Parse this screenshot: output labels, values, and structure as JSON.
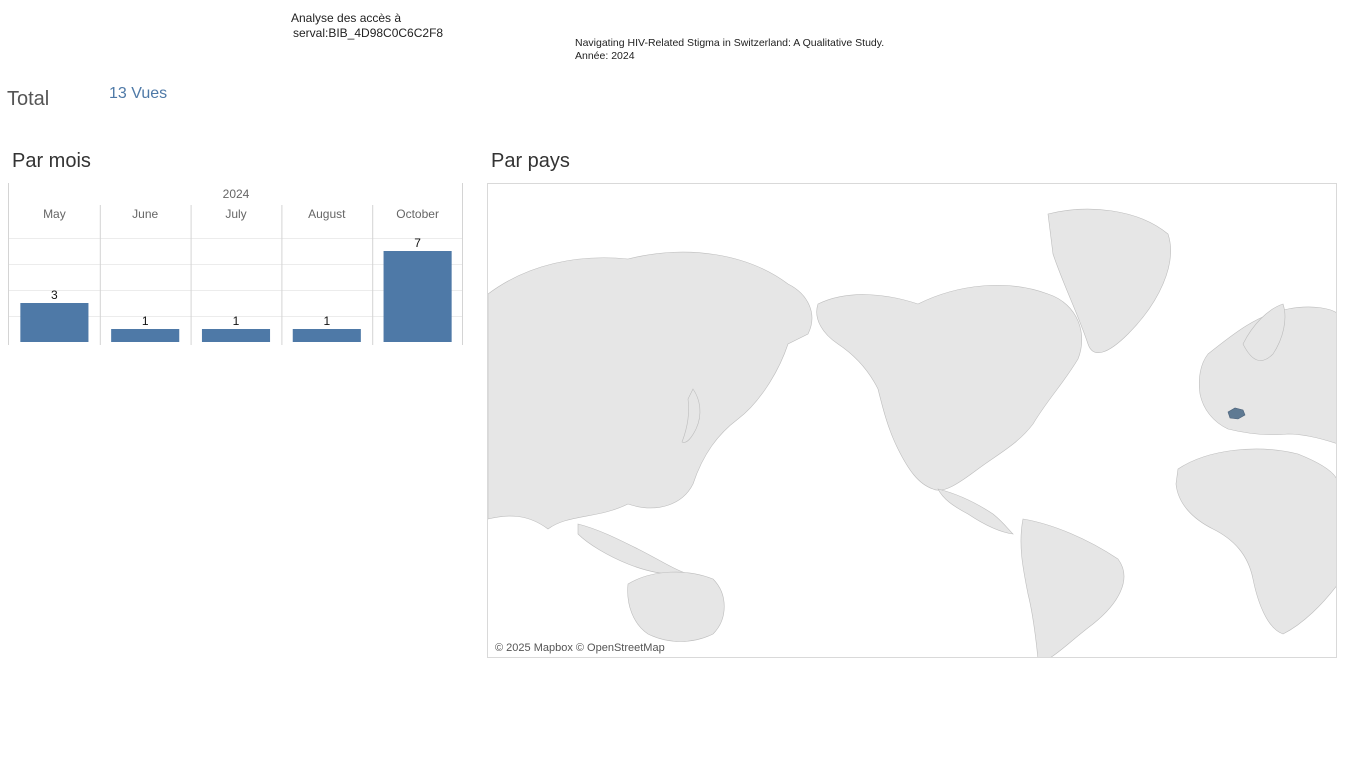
{
  "header": {
    "line1": "Analyse des accès à",
    "line2": "serval:BIB_4D98C0C6C2F8"
  },
  "publication": {
    "title": "Navigating HIV-Related Stigma in Switzerland: A Qualitative Study.",
    "year_line": "Année: 2024"
  },
  "total": {
    "label": "Total",
    "value": "13 Vues"
  },
  "sections": {
    "by_month": "Par mois",
    "by_country": "Par pays"
  },
  "chart_data": [
    {
      "type": "bar",
      "title": "Par mois",
      "year": "2024",
      "categories": [
        "May",
        "June",
        "July",
        "August",
        "October"
      ],
      "values": [
        3,
        1,
        1,
        1,
        7
      ],
      "ylim": [
        0,
        8
      ],
      "grid": true,
      "color": "#4e79a7"
    },
    {
      "type": "map",
      "title": "Par pays",
      "regions": [
        {
          "name": "Switzerland",
          "value": 13
        }
      ],
      "highlight_color": "#5f7a93",
      "land_color": "#e5e5e5"
    }
  ],
  "map": {
    "attribution": "© 2025 Mapbox © OpenStreetMap"
  }
}
